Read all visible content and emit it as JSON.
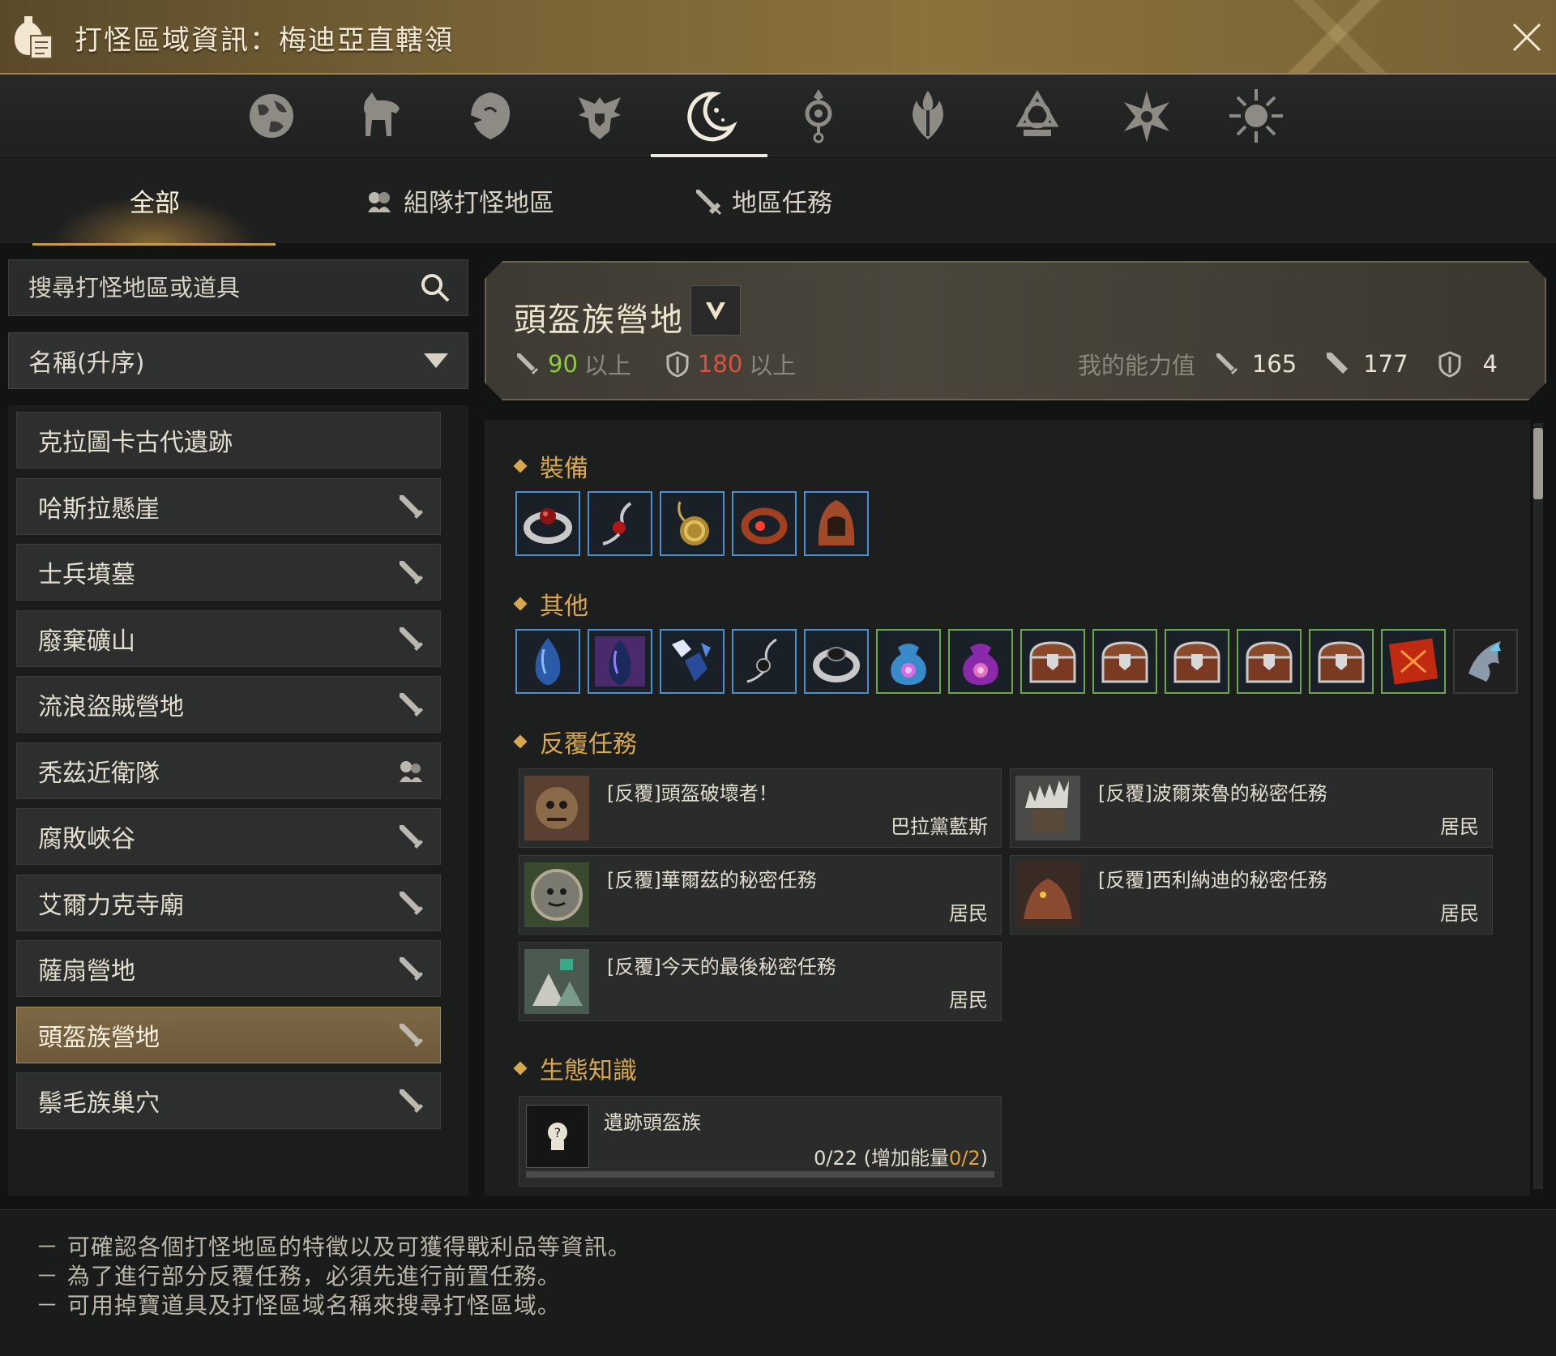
{
  "window": {
    "title": "打怪區域資訊：梅迪亞直轄領"
  },
  "icon_tabs": [
    {
      "name": "globe-icon",
      "active": false
    },
    {
      "name": "horse-icon",
      "active": false
    },
    {
      "name": "lion-icon",
      "active": false
    },
    {
      "name": "eagle-crest-icon",
      "active": false
    },
    {
      "name": "crescent-moon-icon",
      "active": true
    },
    {
      "name": "orb-pendant-icon",
      "active": false
    },
    {
      "name": "flame-crest-icon",
      "active": false
    },
    {
      "name": "knot-emblem-icon",
      "active": false
    },
    {
      "name": "star-burst-icon",
      "active": false
    },
    {
      "name": "sun-burst-icon",
      "active": false
    }
  ],
  "category_tabs": {
    "all": "全部",
    "party": "組隊打怪地區",
    "quests": "地區任務"
  },
  "search": {
    "placeholder": "搜尋打怪地區或道具"
  },
  "sort": {
    "selected": "名稱(升序)"
  },
  "zones": [
    {
      "label": "克拉圖卡古代遺跡",
      "icon": "none"
    },
    {
      "label": "哈斯拉懸崖",
      "icon": "sword-icon"
    },
    {
      "label": "士兵墳墓",
      "icon": "sword-icon"
    },
    {
      "label": "廢棄礦山",
      "icon": "sword-icon"
    },
    {
      "label": "流浪盜賊營地",
      "icon": "sword-icon"
    },
    {
      "label": "秃茲近衛隊",
      "icon": "party-icon"
    },
    {
      "label": "腐敗峽谷",
      "icon": "sword-icon"
    },
    {
      "label": "艾爾力克寺廟",
      "icon": "sword-icon"
    },
    {
      "label": "薩扇營地",
      "icon": "sword-icon"
    },
    {
      "label": "頭盔族營地",
      "icon": "sword-icon",
      "selected": true
    },
    {
      "label": "鬃毛族巢穴",
      "icon": "sword-icon"
    }
  ],
  "zone_info": {
    "name": "頭盔族營地",
    "req_attack": "90",
    "req_attack_suffix": "以上",
    "req_defense": "180",
    "req_defense_suffix": "以上",
    "my_stats_label": "我的能力值",
    "my_ap": "165",
    "my_aap": "177",
    "my_dp": "4"
  },
  "sections": {
    "equipment": "裝備",
    "other": "其他",
    "repeat_quests": "反覆任務",
    "knowledge": "生態知識"
  },
  "equipment_items": [
    {
      "name": "silver-ring-icon",
      "border": "blue"
    },
    {
      "name": "red-earring-icon",
      "border": "blue"
    },
    {
      "name": "gold-necklace-icon",
      "border": "blue"
    },
    {
      "name": "ruby-ring-icon",
      "border": "blue"
    },
    {
      "name": "hood-helmet-icon",
      "border": "blue"
    }
  ],
  "other_items": [
    {
      "name": "blue-crystal-icon",
      "border": "blue"
    },
    {
      "name": "purple-crystal-icon",
      "border": "blue"
    },
    {
      "name": "blue-shards-icon",
      "border": "blue"
    },
    {
      "name": "black-earring-icon",
      "border": "blue"
    },
    {
      "name": "dark-ring-icon",
      "border": "blue"
    },
    {
      "name": "blue-pouch-icon",
      "border": "green"
    },
    {
      "name": "purple-pouch-icon",
      "border": "green"
    },
    {
      "name": "treasure-chest-icon",
      "border": "green"
    },
    {
      "name": "treasure-chest-icon",
      "border": "green"
    },
    {
      "name": "treasure-chest-icon",
      "border": "green"
    },
    {
      "name": "treasure-chest-icon",
      "border": "green"
    },
    {
      "name": "treasure-chest-icon",
      "border": "green"
    },
    {
      "name": "red-book-icon",
      "border": "green"
    },
    {
      "name": "crystal-claw-icon",
      "border": "grey"
    }
  ],
  "quests": [
    {
      "name": "[反覆]頭盔破壞者！",
      "npc": "巴拉黨藍斯",
      "thumb": "helmet-thumb"
    },
    {
      "name": "[反覆]波爾萊魯的秘密任務",
      "npc": "居民",
      "thumb": "spiked-helmet-thumb"
    },
    {
      "name": "[反覆]華爾茲的秘密任務",
      "npc": "居民",
      "thumb": "shield-face-thumb"
    },
    {
      "name": "[反覆]西利納迪的秘密任務",
      "npc": "居民",
      "thumb": "beast-thumb"
    },
    {
      "name": "[反覆]今天的最後秘密任務",
      "npc": "居民",
      "thumb": "camp-thumb"
    }
  ],
  "knowledge": {
    "name": "遺跡頭盔族",
    "progress_prefix": "0/22 (增加能量",
    "progress_highlight": "0/2",
    "progress_suffix": ")",
    "progress_fraction": 0
  },
  "footer_notes": [
    "－ 可確認各個打怪地區的特徵以及可獲得戰利品等資訊。",
    "－ 為了進行部分反覆任務，必須先進行前置任務。",
    "－ 可用掉寶道具及打怪區域名稱來搜尋打怪區域。"
  ],
  "colors": {
    "accent_gold": "#d7a84f",
    "req_ok": "#8ccf3c",
    "req_fail": "#e05040",
    "item_blue": "#4a8fd0",
    "item_green": "#6aa84a",
    "selected_zone": "#7c6745"
  }
}
